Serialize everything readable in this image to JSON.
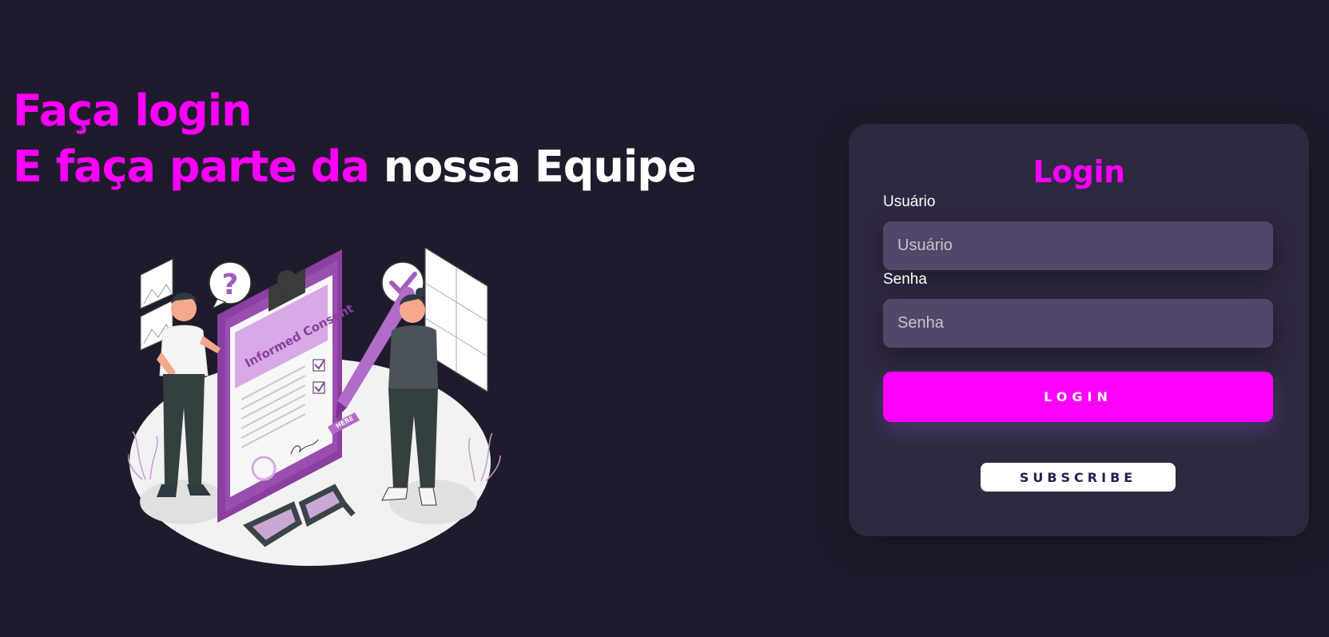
{
  "hero": {
    "line1": "Faça login",
    "line2_pink": "E faça parte da",
    "line2_white": "nossa Equipe"
  },
  "illustration": {
    "label": "Informed Consent",
    "here_tag": "HERE",
    "question_mark": "?"
  },
  "login_card": {
    "title": "Login",
    "username_label": "Usuário",
    "username_placeholder": "Usuário",
    "password_label": "Senha",
    "password_placeholder": "Senha",
    "login_button": "LOGIN",
    "subscribe_button": "SUBSCRIBE"
  },
  "colors": {
    "background": "#201b2c",
    "card": "#2f2841",
    "input": "#514869",
    "accent": "#ff00ff"
  }
}
